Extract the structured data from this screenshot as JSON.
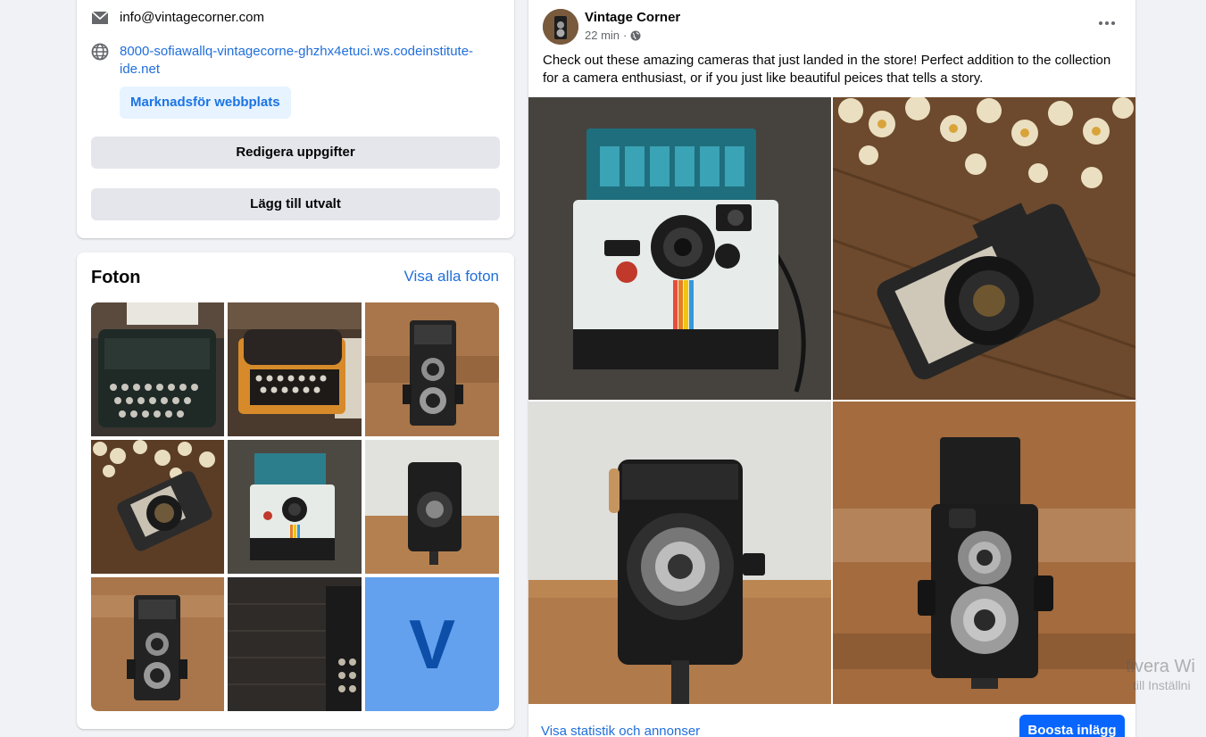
{
  "intro": {
    "email": "info@vintagecorner.com",
    "website": "8000-sofiawallq-vintagecorne-ghzhx4etuci.ws.codeinstitute-ide.net",
    "promote_label": "Marknadsför webbplats",
    "edit_label": "Redigera uppgifter",
    "featured_label": "Lägg till utvalt",
    "icons": [
      "mail-icon",
      "globe-icon"
    ]
  },
  "photos": {
    "title": "Foton",
    "see_all": "Visa alla foton",
    "items": [
      {
        "name": "typewriter-dark"
      },
      {
        "name": "typewriter-orange"
      },
      {
        "name": "tlr-camera-wood"
      },
      {
        "name": "praktica-camera-flowers"
      },
      {
        "name": "polaroid-camera"
      },
      {
        "name": "folding-camera"
      },
      {
        "name": "tlr-camera-wood-2"
      },
      {
        "name": "typewriter-wood"
      },
      {
        "name": "logo-v",
        "letter": "V"
      }
    ]
  },
  "post": {
    "author": "Vintage Corner",
    "time": "22 min",
    "privacy_icon": "globe-icon",
    "text": "Check out these amazing cameras that just landed in the store! Perfect addition to the collection for a camera enthusiast, or if you just like beautiful peices that tells a story.",
    "images": [
      "polaroid-onestep-camera",
      "praktica-camera-with-flowers",
      "prontor-folding-camera",
      "yashica-tlr-camera"
    ],
    "stats_link": "Visa statistik och annonser",
    "boost_label": "Boosta inlägg"
  },
  "watermark": {
    "line1": "tivera Wi",
    "line2": "till Inställni"
  },
  "colors": {
    "link": "#216fdb",
    "primary": "#0866ff",
    "background": "#f0f2f5"
  }
}
